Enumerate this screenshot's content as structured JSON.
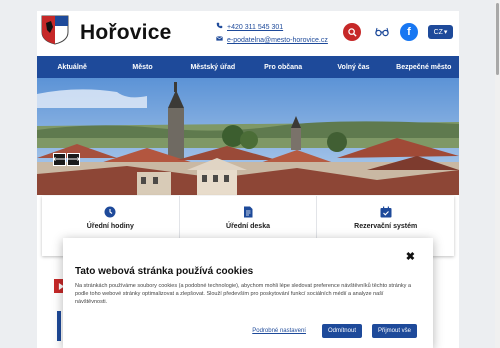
{
  "header": {
    "town_name": "Hořovice",
    "phone": "+420 311 545 301",
    "email": "e-podatelna@mesto-horovice.cz",
    "lang": "CZ",
    "icons": [
      "phone-icon",
      "mail-icon",
      "search-icon",
      "glasses-icon",
      "facebook-icon",
      "chevron-down-icon"
    ],
    "fb_letter": "f",
    "dropdown_glyph": "▾"
  },
  "nav": {
    "items": [
      "Aktuálně",
      "Město",
      "Městský úřad",
      "Pro občana",
      "Volný čas",
      "Bezpečné město"
    ]
  },
  "hero": {
    "prev_arrow": "⟵",
    "next_arrow": "⟶"
  },
  "tiles": [
    {
      "label": "Úřední hodiny",
      "icon": "clock-icon"
    },
    {
      "label": "Úřední deska",
      "icon": "document-icon"
    },
    {
      "label": "Rezervační systém",
      "icon": "calendar-check-icon"
    }
  ],
  "cookie": {
    "title": "Tato webová stránka používá cookies",
    "text": "Na stránkách používáme soubory cookies (a podobné technologie), abychom mohli lépe sledovat preference návštěvníků těchto stránky a podle toho webové stránky optimalizovat a zlepšovat. Slouží především pro poskytování funkcí sociálních médií a analyze naší návštěvnosti.",
    "settings_label": "Podrobné nastavení",
    "decline_label": "Odmítnout",
    "accept_label": "Přijmout vše",
    "close_glyph": "✖"
  },
  "colors": {
    "brand_blue": "#1e4a9a",
    "search_red": "#c62828",
    "facebook_blue": "#1877f2"
  }
}
